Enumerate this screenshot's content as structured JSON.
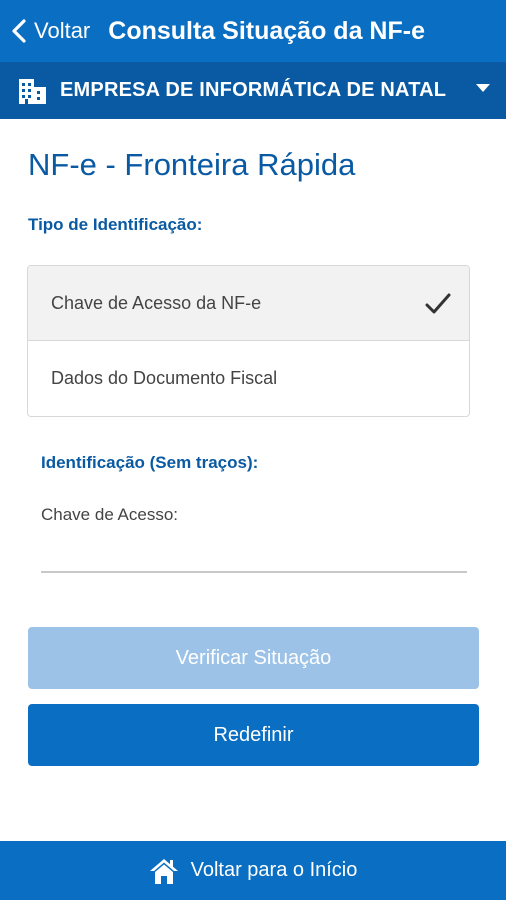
{
  "header": {
    "back_label": "Voltar",
    "title": "Consulta Situação da NF-e"
  },
  "company": {
    "name": "EMPRESA DE INFORMÁTICA DE NATAL",
    "icon": "building-icon"
  },
  "page": {
    "title": "NF-e - Fronteira Rápida"
  },
  "identification_type": {
    "label": "Tipo de Identificação:",
    "options": [
      {
        "label": "Chave de Acesso da NF-e",
        "selected": true
      },
      {
        "label": "Dados do Documento Fiscal",
        "selected": false
      }
    ]
  },
  "identification": {
    "label": "Identificação (Sem traços):",
    "field_label": "Chave de Acesso:",
    "field_value": ""
  },
  "buttons": {
    "verify_label": "Verificar Situação",
    "reset_label": "Redefinir"
  },
  "footer": {
    "label": "Voltar para o Início",
    "icon": "home-icon"
  },
  "colors": {
    "primary": "#0a6fc2",
    "primary_dark": "#0a5aa3",
    "disabled_button": "#9cc3e7"
  }
}
